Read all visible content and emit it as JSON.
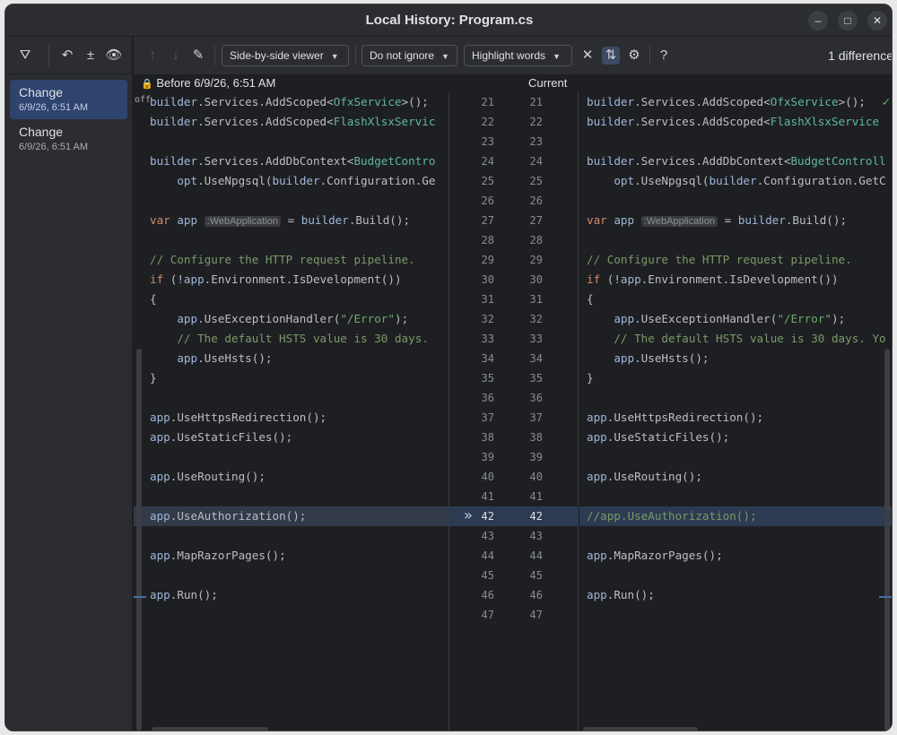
{
  "window": {
    "title": "Local History: Program.cs"
  },
  "sidebar": {
    "items": [
      {
        "title": "Change",
        "date": "6/9/26, 6:51 AM"
      },
      {
        "title": "Change",
        "date": "6/9/26, 6:51 AM"
      }
    ]
  },
  "toolbar": {
    "viewer": "Side-by-side viewer",
    "ignore": "Do not ignore",
    "highlight": "Highlight words",
    "help": "?",
    "diff_count": "1 difference"
  },
  "headers": {
    "left": "Before 6/9/26, 6:51 AM",
    "right": "Current",
    "off": "off"
  },
  "gutter": {
    "left_numbers": [
      "21",
      "22",
      "23",
      "24",
      "25",
      "26",
      "27",
      "28",
      "29",
      "30",
      "31",
      "32",
      "33",
      "34",
      "35",
      "36",
      "37",
      "38",
      "39",
      "40",
      "41",
      "42",
      "43",
      "44",
      "45",
      "46",
      "47"
    ],
    "right_numbers": [
      "21",
      "22",
      "23",
      "24",
      "25",
      "26",
      "27",
      "28",
      "29",
      "30",
      "31",
      "32",
      "33",
      "34",
      "35",
      "36",
      "37",
      "38",
      "39",
      "40",
      "41",
      "42",
      "43",
      "44",
      "45",
      "46",
      "47"
    ],
    "apply_arrow": "»"
  },
  "hints": {
    "webapp": ":WebApplication"
  },
  "code_left": {
    "l21_a": "builder",
    "l21_b": ".Services.AddScoped<",
    "l21_c": "OfxService",
    "l21_d": ">();",
    "l22_a": "builder",
    "l22_b": ".Services.AddScoped<",
    "l22_c": "FlashXlsxServic",
    "l24_a": "builder",
    "l24_b": ".Services.AddDbContext<",
    "l24_c": "BudgetContro",
    "l25_a": "    opt",
    "l25_b": ".UseNpgsql(",
    "l25_c": "builder",
    "l25_d": ".Configuration.Ge",
    "l27_a": "var ",
    "l27_b": "app",
    "l27_c": " = ",
    "l27_d": "builder",
    "l27_e": ".Build();",
    "l29": "// Configure the HTTP request pipeline.",
    "l30_a": "if ",
    "l30_b": "(!",
    "l30_c": "app",
    "l30_d": ".Environment.IsDevelopment())",
    "l31": "{",
    "l32_a": "    app",
    "l32_b": ".UseExceptionHandler(",
    "l32_c": "\"/Error\"",
    "l32_d": ");",
    "l33": "    // The default HSTS value is 30 days.",
    "l34_a": "    app",
    "l34_b": ".UseHsts();",
    "l35": "}",
    "l37_a": "app",
    "l37_b": ".UseHttpsRedirection();",
    "l38_a": "app",
    "l38_b": ".UseStaticFiles();",
    "l40_a": "app",
    "l40_b": ".UseRouting();",
    "l42_a": "app",
    "l42_b": ".UseAuthorization();",
    "l44_a": "app",
    "l44_b": ".MapRazorPages();",
    "l46_a": "app",
    "l46_b": ".Run();"
  },
  "code_right": {
    "l21_a": "builder",
    "l21_b": ".Services.AddScoped<",
    "l21_c": "OfxService",
    "l21_d": ">();",
    "l22_a": "builder",
    "l22_b": ".Services.AddScoped<",
    "l22_c": "FlashXlsxService",
    "l24_a": "builder",
    "l24_b": ".Services.AddDbContext<",
    "l24_c": "BudgetControll",
    "l25_a": "    opt",
    "l25_b": ".UseNpgsql(",
    "l25_c": "builder",
    "l25_d": ".Configuration.GetC",
    "l27_a": "var ",
    "l27_b": "app",
    "l27_c": " = ",
    "l27_d": "builder",
    "l27_e": ".Build();",
    "l29": "// Configure the HTTP request pipeline.",
    "l30_a": "if ",
    "l30_b": "(!",
    "l30_c": "app",
    "l30_d": ".Environment.IsDevelopment())",
    "l31": "{",
    "l32_a": "    app",
    "l32_b": ".UseExceptionHandler(",
    "l32_c": "\"/Error\"",
    "l32_d": ");",
    "l33": "    // The default HSTS value is 30 days. Yo",
    "l34_a": "    app",
    "l34_b": ".UseHsts();",
    "l35": "}",
    "l37_a": "app",
    "l37_b": ".UseHttpsRedirection();",
    "l38_a": "app",
    "l38_b": ".UseStaticFiles();",
    "l40_a": "app",
    "l40_b": ".UseRouting();",
    "l42": "//app.UseAuthorization();",
    "l44_a": "app",
    "l44_b": ".MapRazorPages();",
    "l46_a": "app",
    "l46_b": ".Run();"
  }
}
